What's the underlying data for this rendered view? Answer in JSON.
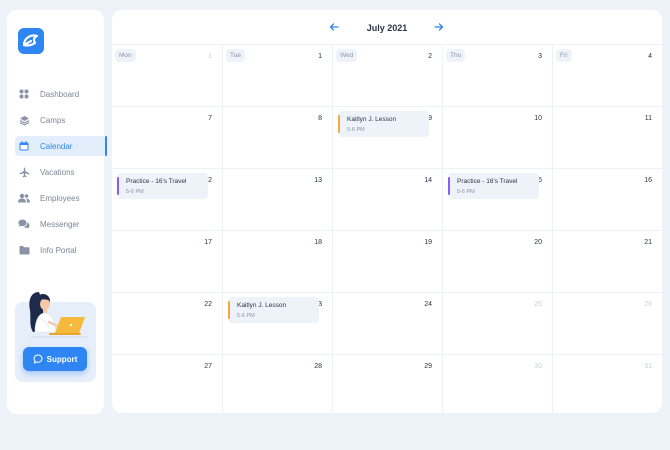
{
  "sidebar": {
    "items": [
      {
        "label": "Dashboard",
        "icon": "dashboard-icon",
        "active": false
      },
      {
        "label": "Camps",
        "icon": "layers-icon",
        "active": false
      },
      {
        "label": "Calendar",
        "icon": "calendar-icon",
        "active": true
      },
      {
        "label": "Vacations",
        "icon": "plane-icon",
        "active": false
      },
      {
        "label": "Employees",
        "icon": "users-icon",
        "active": false
      },
      {
        "label": "Messenger",
        "icon": "chat-icon",
        "active": false
      },
      {
        "label": "Info Portal",
        "icon": "folder-icon",
        "active": false
      }
    ],
    "support_label": "Support"
  },
  "calendar": {
    "month": "July 2021",
    "weekdays": [
      "Mon",
      "Tue",
      "Wed",
      "Thu",
      "Fri"
    ],
    "weeks": [
      [
        {
          "d": "1",
          "muted": true
        },
        {
          "d": "1"
        },
        {
          "d": "2"
        },
        {
          "d": "3"
        },
        {
          "d": "4"
        }
      ],
      [
        {
          "d": "7"
        },
        {
          "d": "8"
        },
        {
          "d": "9"
        },
        {
          "d": "10"
        },
        {
          "d": "11"
        }
      ],
      [
        {
          "d": "12"
        },
        {
          "d": "13"
        },
        {
          "d": "14"
        },
        {
          "d": "15"
        },
        {
          "d": "16"
        }
      ],
      [
        {
          "d": "17"
        },
        {
          "d": "18"
        },
        {
          "d": "19"
        },
        {
          "d": "20"
        },
        {
          "d": "21"
        }
      ],
      [
        {
          "d": "22"
        },
        {
          "d": "23"
        },
        {
          "d": "24"
        },
        {
          "d": "25",
          "muted": true
        },
        {
          "d": "26",
          "muted": true
        }
      ],
      [
        {
          "d": "27"
        },
        {
          "d": "28"
        },
        {
          "d": "29"
        },
        {
          "d": "30",
          "muted": true
        },
        {
          "d": "31",
          "muted": true
        }
      ]
    ],
    "events": [
      {
        "week": 1,
        "day": 2,
        "title": "Kaitlyn J. Lesson",
        "time": "5-6 PM",
        "color": "#f5a742"
      },
      {
        "week": 2,
        "day": 0,
        "title": "Practice - 16's Travel",
        "time": "5-6 PM",
        "color": "#8a5cf6"
      },
      {
        "week": 2,
        "day": 3,
        "title": "Practice - 16's Travel",
        "time": "5-6 PM",
        "color": "#8a5cf6"
      },
      {
        "week": 4,
        "day": 1,
        "title": "Kaitlyn J. Lesson",
        "time": "5-6 PM",
        "color": "#f5a742"
      }
    ]
  },
  "colors": {
    "accent": "#2f86f2",
    "lesson": "#f5a742",
    "practice": "#8a5cf6"
  }
}
